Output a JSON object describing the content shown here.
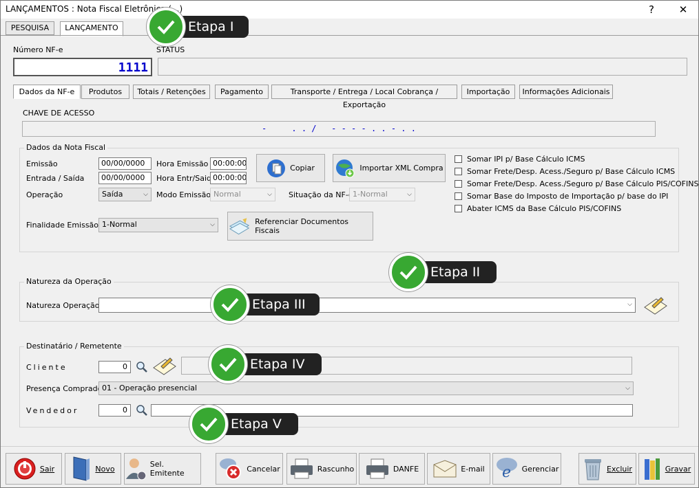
{
  "window": {
    "title": "LANÇAMENTOS : Nota Fiscal Eletrônica (...)",
    "help": "?",
    "close": "✕"
  },
  "main_tabs": [
    {
      "label": "PESQUISA"
    },
    {
      "label": "LANÇAMENTO"
    }
  ],
  "header": {
    "numero_label": "Número NF-e",
    "numero_value": "1111",
    "status_label": "STATUS",
    "status_value": ""
  },
  "sub_tabs": [
    {
      "label": "Dados da NF-e"
    },
    {
      "label": "Produtos"
    },
    {
      "label": "Totais / Retenções"
    },
    {
      "label": "Pagamento"
    },
    {
      "label": "Transporte / Entrega / Local Cobrança / Exportação"
    },
    {
      "label": "Importação"
    },
    {
      "label": "Informações Adicionais"
    }
  ],
  "chave": {
    "label": "CHAVE DE ACESSO",
    "value": "-     . . /   - - - - . . - . ."
  },
  "dados": {
    "title": "Dados da Nota Fiscal",
    "emissao_label": "Emissão",
    "emissao_value": "00/00/0000",
    "hora_emissao_label": "Hora Emissão",
    "hora_emissao_value": "00:00:00",
    "entrada_label": "Entrada / Saída",
    "entrada_value": "00/00/0000",
    "hora_entr_label": "Hora Entr/Said",
    "hora_entr_value": "00:00:00",
    "operacao_label": "Operação",
    "operacao_value": "Saída",
    "modo_label": "Modo Emissão",
    "modo_value": "Normal",
    "situacao_label": "Situação da NF-e",
    "situacao_value": "1-Normal",
    "finalidade_label": "Finalidade Emissão",
    "finalidade_value": "1-Normal",
    "copiar_label": "Copiar",
    "importar_label": "Importar XML Compra",
    "referenciar_label": "Referenciar Documentos Fiscais"
  },
  "checkboxes": [
    {
      "label": "Somar IPI p/ Base Cálculo ICMS"
    },
    {
      "label": "Somar Frete/Desp. Acess./Seguro p/ Base Cálculo ICMS"
    },
    {
      "label": "Somar Frete/Desp. Acess./Seguro p/ Base Cálculo PIS/COFINS"
    },
    {
      "label": "Somar Base do Imposto de Importação p/ base do IPI"
    },
    {
      "label": "Abater ICMS da Base Cálculo PIS/COFINS"
    }
  ],
  "natureza": {
    "title": "Natureza da Operação",
    "label": "Natureza Operação",
    "value": ""
  },
  "destinatario": {
    "title": "Destinatário / Remetente",
    "cliente_label": "Cliente",
    "cliente_value": "0",
    "presenca_label": "Presença Comprador",
    "presenca_value": "01 - Operação presencial",
    "vendedor_label": "Vendedor",
    "vendedor_value": "0"
  },
  "bottom_buttons": [
    {
      "label": "Sair"
    },
    {
      "label": "Novo"
    },
    {
      "label": "Sel. Emitente"
    },
    {
      "label": "Cancelar"
    },
    {
      "label": "Rascunho"
    },
    {
      "label": "DANFE"
    },
    {
      "label": "E-mail"
    },
    {
      "label": "Gerenciar"
    },
    {
      "label": "Excluir"
    },
    {
      "label": "Gravar"
    }
  ],
  "badges": [
    {
      "label": "Etapa I"
    },
    {
      "label": "Etapa II"
    },
    {
      "label": "Etapa III"
    },
    {
      "label": "Etapa IV"
    },
    {
      "label": "Etapa V"
    }
  ],
  "colors": {
    "accent_number": "#0000cc",
    "badge_green": "#38a832",
    "badge_dark": "#222222"
  }
}
